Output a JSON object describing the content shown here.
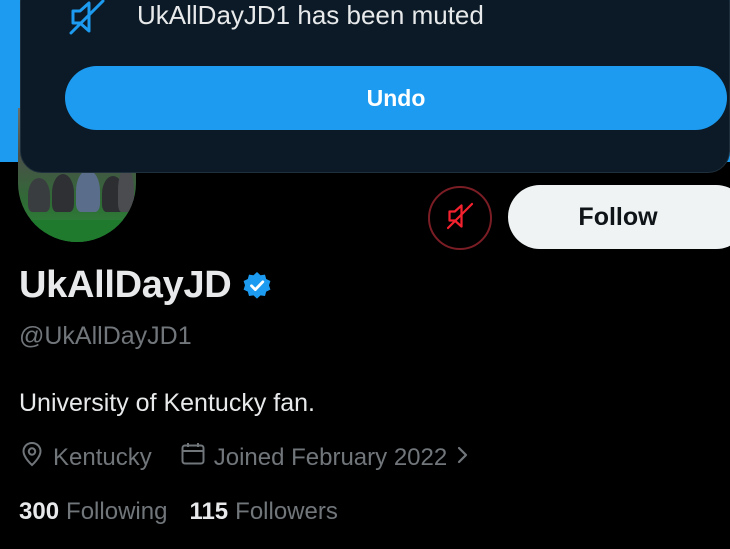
{
  "toast": {
    "message": "UkAllDayJD1 has been muted",
    "undo_label": "Undo",
    "icon": "muted-speaker-icon"
  },
  "profile": {
    "display_name": "UkAllDayJD",
    "handle": "@UkAllDayJD1",
    "bio": "University of Kentucky fan.",
    "location": "Kentucky",
    "joined": "Joined February 2022",
    "verified": true
  },
  "actions": {
    "follow_label": "Follow",
    "mute_icon": "muted-speaker-icon"
  },
  "stats": {
    "following_count": "300",
    "following_label": "Following",
    "followers_count": "115",
    "followers_label": "Followers"
  },
  "colors": {
    "accent": "#1d9bf0",
    "muted_red": "#f4212e",
    "background": "#000000",
    "secondary_text": "#71767b"
  }
}
